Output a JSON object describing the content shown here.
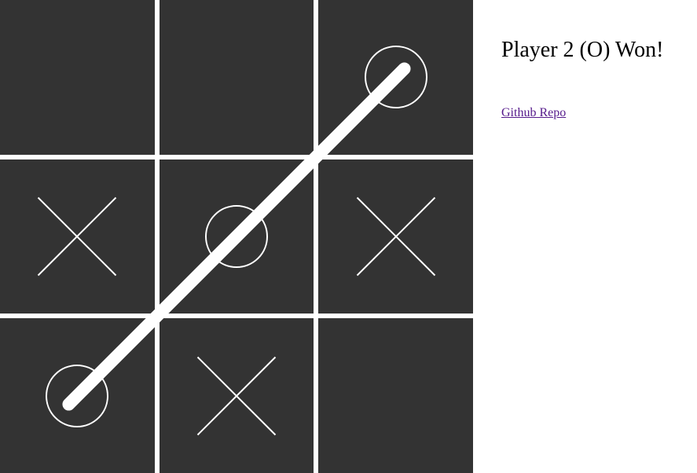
{
  "game": {
    "status_text": "Player 2 (O) Won!",
    "board": [
      [
        "",
        "",
        "O"
      ],
      [
        "X",
        "O",
        "X"
      ],
      [
        "O",
        "X",
        ""
      ]
    ],
    "winner": "O",
    "win_line": "anti-diagonal"
  },
  "links": {
    "github_label": "Github Repo"
  },
  "colors": {
    "cell_bg": "#333333",
    "mark": "#ffffff",
    "grid_gap": "#ffffff"
  }
}
